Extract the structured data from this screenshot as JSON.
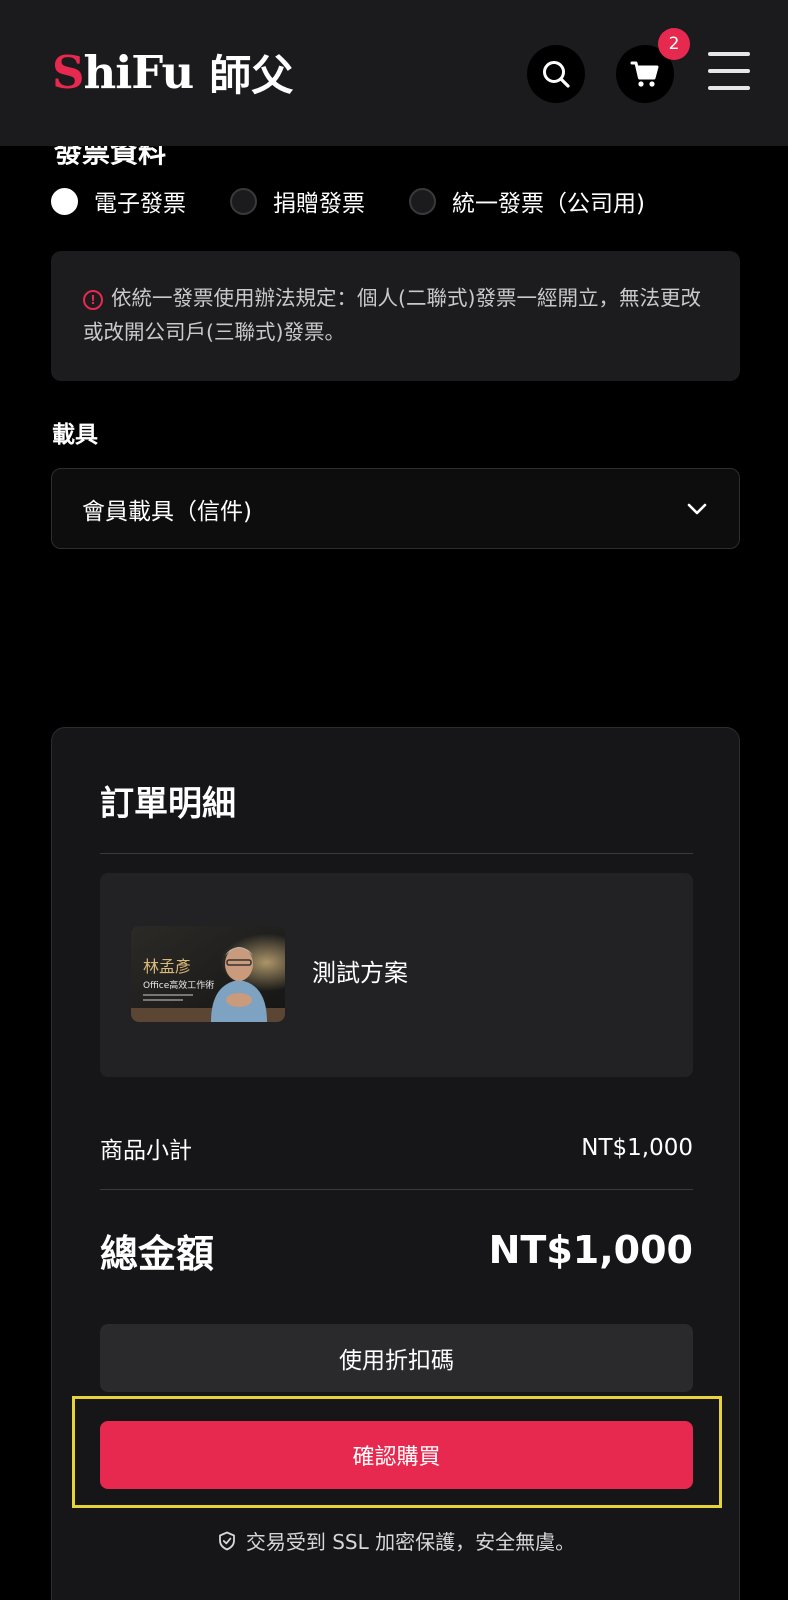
{
  "header": {
    "logo_en_first": "S",
    "logo_en_rest": "hiFu",
    "logo_zh": "師父",
    "cart_count": "2",
    "icons": [
      "search-icon",
      "cart-icon",
      "menu-icon"
    ]
  },
  "invoice": {
    "section_title": "發票資料",
    "options": [
      {
        "label": "電子發票",
        "selected": true
      },
      {
        "label": "捐贈發票",
        "selected": false
      },
      {
        "label": "統一發票（公司用)",
        "selected": false
      }
    ],
    "notice": "依統一發票使用辦法規定：個人(二聯式)發票一經開立，無法更改或改開公司戶(三聯式)發票。",
    "carrier_label": "載具",
    "carrier_value": "會員載具（信件)"
  },
  "order": {
    "title": "訂單明細",
    "product_name": "測試方案",
    "thumb_title": "林孟彥",
    "thumb_subtitle": "Office高效工作術",
    "subtotal_label": "商品小計",
    "subtotal_value": "NT$1,000",
    "total_label": "總金額",
    "total_value": "NT$1,000",
    "coupon_button": "使用折扣碼",
    "buy_button": "確認購買",
    "ssl_note": "交易受到 SSL 加密保護，安全無虞。"
  },
  "colors": {
    "accent": "#e8294f",
    "background": "#000000",
    "header": "#1b1b1d",
    "highlight": "#e6d33a"
  }
}
